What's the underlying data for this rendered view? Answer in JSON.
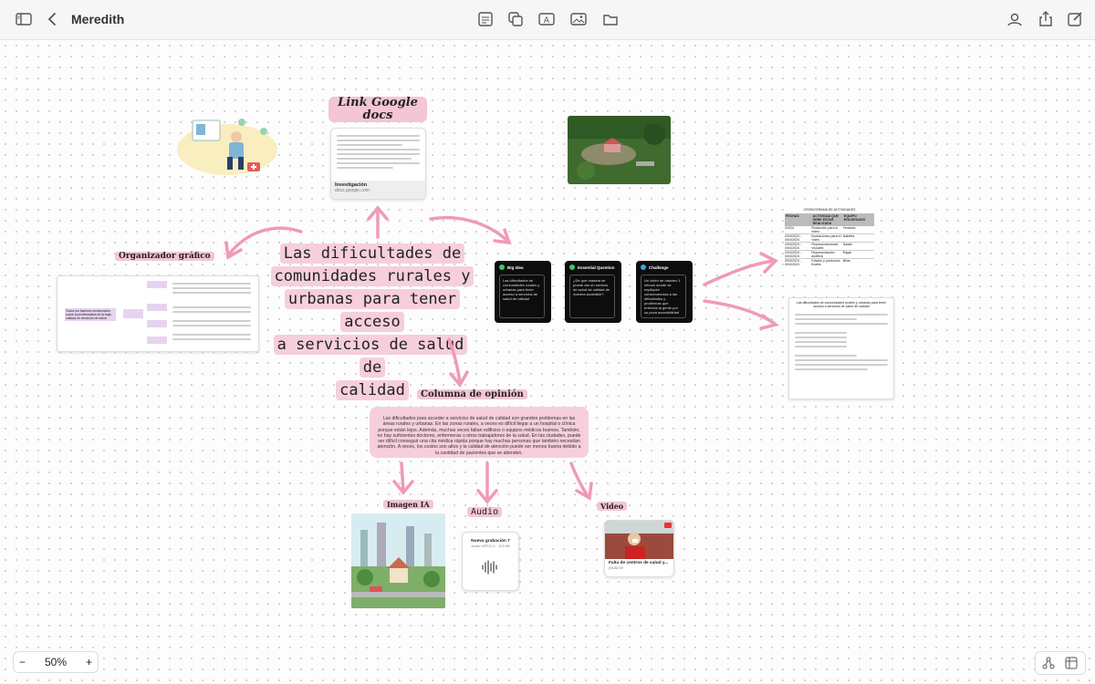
{
  "app": {
    "title": "Meredith",
    "zoom": "50%",
    "zoom_out": "−",
    "zoom_in": "+"
  },
  "board": {
    "main_title": [
      "Las dificultades de",
      "comunidades rurales y",
      "urbanas  para tener acceso",
      "a servicios de salud de",
      "calidad"
    ],
    "link_label": "Link Google docs",
    "doc_card_title": "Investigación",
    "doc_card_url": "docs.google.com",
    "organizer_label": "Organizador gráfico",
    "organizer_center": "Todos los factores involucrados sobre la problemática de la baja calidad en servicios de salud",
    "cards": [
      {
        "title": "Big Idea",
        "text": "Las dificultades de comunidades rurales y urbanas para tener acceso a servicios de salud de calidad"
      },
      {
        "title": "Essential Question",
        "text": "¿De qué manera se puede dar un servicio de salud de calidad de manera accesible?"
      },
      {
        "title": "Challenge",
        "text": "Un video de máximo 1 minuto donde se expliquen consecuencias a las dificultades y problemas que enfrenta la gente por su poca accesibilidad"
      }
    ],
    "schedule_title": "CRONOGRAMA DE ACTIVIDADES",
    "schedule_headers": [
      "FECHAS",
      "ACTIVIDAD QUE DEBE ESTAR REALIZADA",
      "EQUIPO ENCARGADO"
    ],
    "schedule_rows": [
      [
        "3/4/24",
        "Redacción para el video",
        "Yeraldux"
      ],
      [
        "2/04/2024 - 4/04/2024",
        "Ilustraciones para el video",
        "Isabella"
      ],
      [
        "2/04/2024 - 4/04/2024",
        "Representaciones visuales",
        "Sarahi"
      ],
      [
        "2/04/2024 - 4/04/2024",
        "Representación auditiva",
        "Edgar"
      ],
      [
        "3/04/2024 - 4/04/2024",
        "Edición y productos finales",
        "Brian"
      ]
    ],
    "notes_title": "Las dificultades de comunidades rurales y urbanas para tener acceso a servicios de salud de calidad",
    "opinion_label": "Columna de opinión",
    "opinion_text": "Las dificultades para acceder a servicios de salud de calidad son grandes problemas en las áreas rurales y urbanas. En las zonas rurales, a veces es difícil llegar a un hospital o clínica porque están lejos. Además, muchas veces faltan edificios o equipos médicos buenos. También, no hay suficientes doctores, enfermeras u otros trabajadores de la salud. En las ciudades, puede ser difícil conseguir una cita médica rápida porque hay muchas personas que también necesitan atención. A veces, los costos son altos y la calidad de atención puede ser menos buena debido a la cantidad de pacientes que se atienden.",
    "image_label": "Imagen IA",
    "audio_label": "Audio",
    "audio_title": "Nueva grabación 7",
    "audio_meta": "audio MPEG-4 · 420 kB",
    "video_label": "Video",
    "video_title": "Falta de centros de salud y...",
    "video_url": "youtu.be"
  }
}
